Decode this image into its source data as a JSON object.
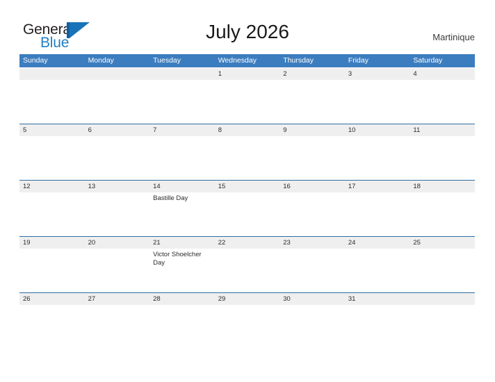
{
  "brand": {
    "name_part1": "General",
    "name_part2": "Blue",
    "flag_icon": "triangle-flag-icon",
    "colors": {
      "dark_text": "#231f20",
      "blue_text": "#1f7fc4",
      "flag_blue": "#1973b8"
    }
  },
  "header": {
    "title": "July 2026",
    "locale": "Martinique"
  },
  "calendar": {
    "colors": {
      "header_blue": "#3c7dbf",
      "rule_blue": "#2d6ca2",
      "band_gray": "#efefef"
    },
    "weekdays": [
      "Sunday",
      "Monday",
      "Tuesday",
      "Wednesday",
      "Thursday",
      "Friday",
      "Saturday"
    ],
    "weeks": [
      [
        {
          "num": "",
          "events": []
        },
        {
          "num": "",
          "events": []
        },
        {
          "num": "",
          "events": []
        },
        {
          "num": "1",
          "events": []
        },
        {
          "num": "2",
          "events": []
        },
        {
          "num": "3",
          "events": []
        },
        {
          "num": "4",
          "events": []
        }
      ],
      [
        {
          "num": "5",
          "events": []
        },
        {
          "num": "6",
          "events": []
        },
        {
          "num": "7",
          "events": []
        },
        {
          "num": "8",
          "events": []
        },
        {
          "num": "9",
          "events": []
        },
        {
          "num": "10",
          "events": []
        },
        {
          "num": "11",
          "events": []
        }
      ],
      [
        {
          "num": "12",
          "events": []
        },
        {
          "num": "13",
          "events": []
        },
        {
          "num": "14",
          "events": [
            "Bastille Day"
          ]
        },
        {
          "num": "15",
          "events": []
        },
        {
          "num": "16",
          "events": []
        },
        {
          "num": "17",
          "events": []
        },
        {
          "num": "18",
          "events": []
        }
      ],
      [
        {
          "num": "19",
          "events": []
        },
        {
          "num": "20",
          "events": []
        },
        {
          "num": "21",
          "events": [
            "Victor Shoelcher Day"
          ]
        },
        {
          "num": "22",
          "events": []
        },
        {
          "num": "23",
          "events": []
        },
        {
          "num": "24",
          "events": []
        },
        {
          "num": "25",
          "events": []
        }
      ],
      [
        {
          "num": "26",
          "events": []
        },
        {
          "num": "27",
          "events": []
        },
        {
          "num": "28",
          "events": []
        },
        {
          "num": "29",
          "events": []
        },
        {
          "num": "30",
          "events": []
        },
        {
          "num": "31",
          "events": []
        },
        {
          "num": "",
          "events": []
        }
      ]
    ]
  }
}
